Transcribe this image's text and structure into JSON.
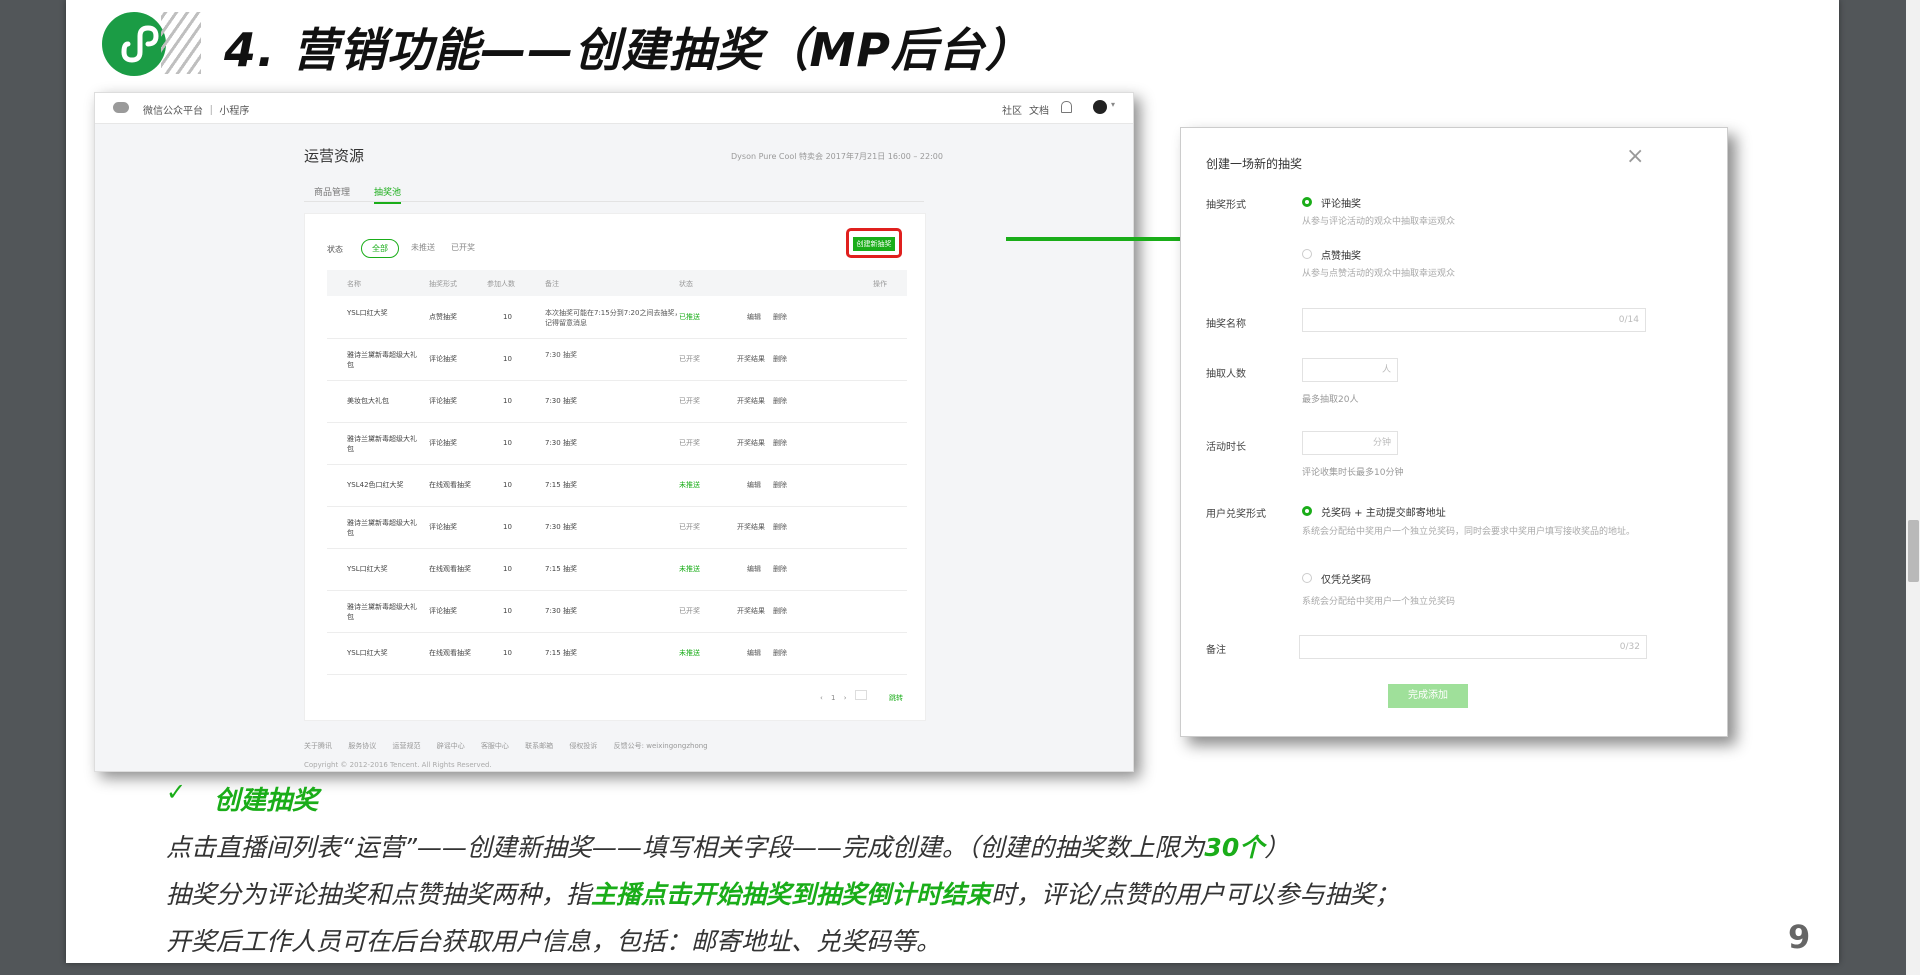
{
  "slide": {
    "title": "4. 营销功能——创建抽奖（MP后台）",
    "page_number": "9"
  },
  "shot1": {
    "topbar": {
      "brand": "微信公众平台 ｜ 小程序",
      "community": "社区",
      "docs": "文档"
    },
    "page_title": "运营资源",
    "meta": "Dyson Pure Cool 特卖会   2017年7月21日 16:00 – 22:00",
    "tabs": [
      "商品管理",
      "抽奖池"
    ],
    "status_label": "状态",
    "filters": [
      "全部",
      "未推送",
      "已开奖"
    ],
    "create_button": "创建新抽奖",
    "columns": [
      "名称",
      "抽奖形式",
      "参加人数",
      "备注",
      "状态",
      "操作"
    ],
    "rows": [
      {
        "name": "YSL口红大奖",
        "type": "点赞抽奖",
        "count": "10",
        "note": "本次抽奖可能在7:15分到7:20之间去抽奖，记得留意消息",
        "status": "已推送",
        "op1": "编辑",
        "op2": "删除"
      },
      {
        "name": "雅诗兰黛新毒超级大礼包",
        "type": "评论抽奖",
        "count": "10",
        "note": "7:30 抽奖",
        "status": "已开奖",
        "op1": "开奖结果",
        "op2": "删除"
      },
      {
        "name": "美妆包大礼包",
        "type": "评论抽奖",
        "count": "10",
        "note": "7:30 抽奖",
        "status": "已开奖",
        "op1": "开奖结果",
        "op2": "删除"
      },
      {
        "name": "雅诗兰黛新毒超级大礼包",
        "type": "评论抽奖",
        "count": "10",
        "note": "7:30 抽奖",
        "status": "已开奖",
        "op1": "开奖结果",
        "op2": "删除"
      },
      {
        "name": "YSL42色口红大奖",
        "type": "在线观看抽奖",
        "count": "10",
        "note": "7:15 抽奖",
        "status": "未推送",
        "op1": "编辑",
        "op2": "删除"
      },
      {
        "name": "雅诗兰黛新毒超级大礼包",
        "type": "评论抽奖",
        "count": "10",
        "note": "7:30 抽奖",
        "status": "已开奖",
        "op1": "开奖结果",
        "op2": "删除"
      },
      {
        "name": "YSL口红大奖",
        "type": "在线观看抽奖",
        "count": "10",
        "note": "7:15 抽奖",
        "status": "未推送",
        "op1": "编辑",
        "op2": "删除"
      },
      {
        "name": "雅诗兰黛新毒超级大礼包",
        "type": "评论抽奖",
        "count": "10",
        "note": "7:30 抽奖",
        "status": "已开奖",
        "op1": "开奖结果",
        "op2": "删除"
      },
      {
        "name": "YSL口红大奖",
        "type": "在线观看抽奖",
        "count": "10",
        "note": "7:15 抽奖",
        "status": "未推送",
        "op1": "编辑",
        "op2": "删除"
      }
    ],
    "pager": {
      "prev": "‹",
      "page": "1",
      "next": "›",
      "input": "",
      "jump": "跳转"
    },
    "footer_links": [
      "关于腾讯",
      "服务协议",
      "运营规范",
      "辟谣中心",
      "客服中心",
      "联系邮箱",
      "侵权投诉",
      "反馈公号: weixingongzhong"
    ],
    "copyright": "Copyright © 2012-2016 Tencent. All Rights Reserved."
  },
  "dialog": {
    "title": "创建一场新的抽奖",
    "close": "×",
    "type_label": "抽奖形式",
    "opt_comment": "评论抽奖",
    "opt_comment_desc": "从参与评论活动的观众中抽取幸运观众",
    "opt_like": "点赞抽奖",
    "opt_like_desc": "从参与点赞活动的观众中抽取幸运观众",
    "name_label": "抽奖名称",
    "name_counter": "0/14",
    "count_label": "抽取人数",
    "count_unit": "人",
    "count_hint": "最多抽取20人",
    "duration_label": "活动时长",
    "duration_unit": "分钟",
    "duration_hint": "评论收集时长最多10分钟",
    "redeem_label": "用户兑奖形式",
    "redeem_opt1": "兑奖码 + 主动提交邮寄地址",
    "redeem_opt1_desc": "系统会分配给中奖用户一个独立兑奖码，同时会要求中奖用户填写接收奖品的地址。",
    "redeem_opt2": "仅凭兑奖码",
    "redeem_opt2_desc": "系统会分配给中奖用户一个独立兑奖码",
    "note_label": "备注",
    "note_counter": "0/32",
    "done_button": "完成添加"
  },
  "text": {
    "check": "✓",
    "section_title": "创建抽奖",
    "line1_a": "点击直播间列表“运营”——创建新抽奖——填写相关字段——完成创建。（创建的抽奖数上限为",
    "line1_hl": "30个",
    "line1_b": "）",
    "line2_a": "抽奖分为评论抽奖和点赞抽奖两种，指",
    "line2_hl": "主播点击开始抽奖到抽奖倒计时结束",
    "line2_b": "时，评论/点赞的用户可以参与抽奖；",
    "line3": "开奖后工作人员可在后台获取用户信息，包括：邮寄地址、兑奖码等。"
  },
  "colors": {
    "accent": "#1aad19",
    "highlight_box": "#e0201e"
  }
}
